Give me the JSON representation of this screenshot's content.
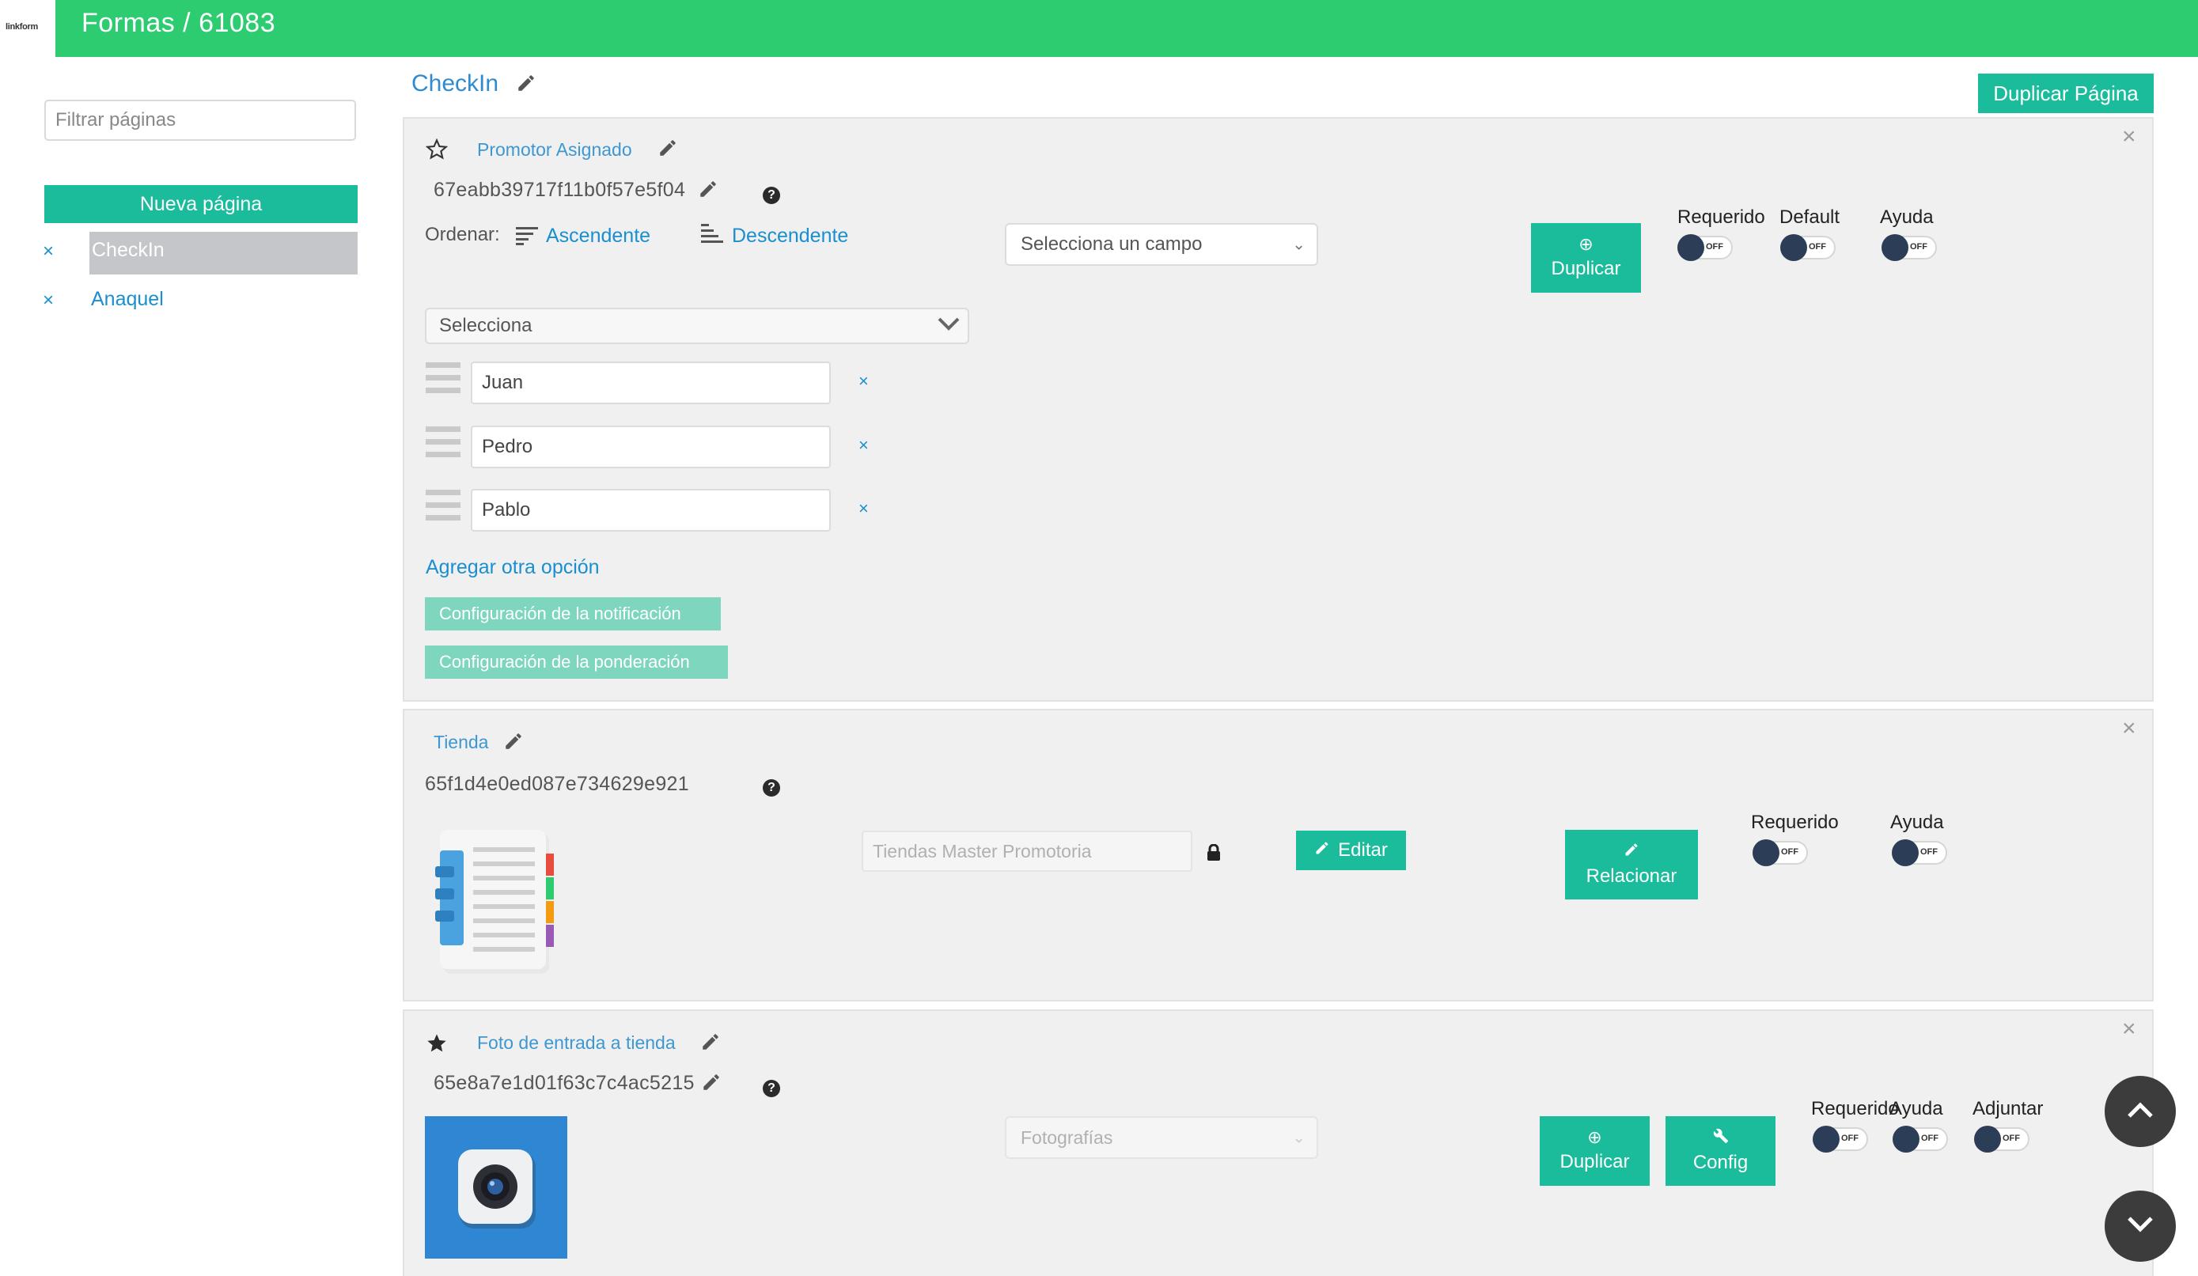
{
  "header": {
    "logo": "linkform",
    "title": "Formas / 61083"
  },
  "sidebar": {
    "filter_placeholder": "Filtrar páginas",
    "new_page_label": "Nueva página",
    "pages": [
      {
        "label": "CheckIn",
        "remove_icon": "×",
        "selected": true
      },
      {
        "label": "Anaquel",
        "remove_icon": "×",
        "selected": false
      }
    ]
  },
  "main": {
    "page_title": "CheckIn",
    "duplicate_page_label": "Duplicar Página",
    "fields": [
      {
        "title": "Promotor Asignado",
        "id": "67eabb39717f11b0f57e5f04",
        "starred": false,
        "sort_label": "Ordenar:",
        "sort_asc": "Ascendente",
        "sort_desc": "Descendente",
        "field_select": "Selecciona un campo",
        "dropdown_preview": "Selecciona",
        "options": [
          "Juan",
          "Pedro",
          "Pablo"
        ],
        "add_option": "Agregar otra opción",
        "notification_config": "Configuración de la notificación",
        "weighting_config": "Configuración de la ponderación",
        "duplicate_label": "Duplicar",
        "toggles": [
          {
            "label": "Requerido",
            "state": "OFF"
          },
          {
            "label": "Default",
            "state": "OFF"
          },
          {
            "label": "Ayuda",
            "state": "OFF"
          }
        ]
      },
      {
        "title": "Tienda",
        "id": "65f1d4e0ed087e734629e921",
        "catalog": "Tiendas Master Promotoria",
        "edit_label": "Editar",
        "relate_label": "Relacionar",
        "toggles": [
          {
            "label": "Requerido",
            "state": "OFF"
          },
          {
            "label": "Ayuda",
            "state": "OFF"
          }
        ]
      },
      {
        "title": "Foto de entrada a tienda",
        "id": "65e8a7e1d01f63c7c4ac5215",
        "starred": true,
        "photo_select": "Fotografías",
        "duplicate_label": "Duplicar",
        "config_label": "Config",
        "toggles": [
          {
            "label": "Requerido",
            "state": "OFF"
          },
          {
            "label": "Ayuda",
            "state": "OFF"
          },
          {
            "label": "Adjuntar",
            "state": "OFF"
          }
        ]
      }
    ]
  },
  "colors": {
    "header": "#2ecc71",
    "accent": "#1abc9c",
    "link": "#1a8fd0"
  }
}
